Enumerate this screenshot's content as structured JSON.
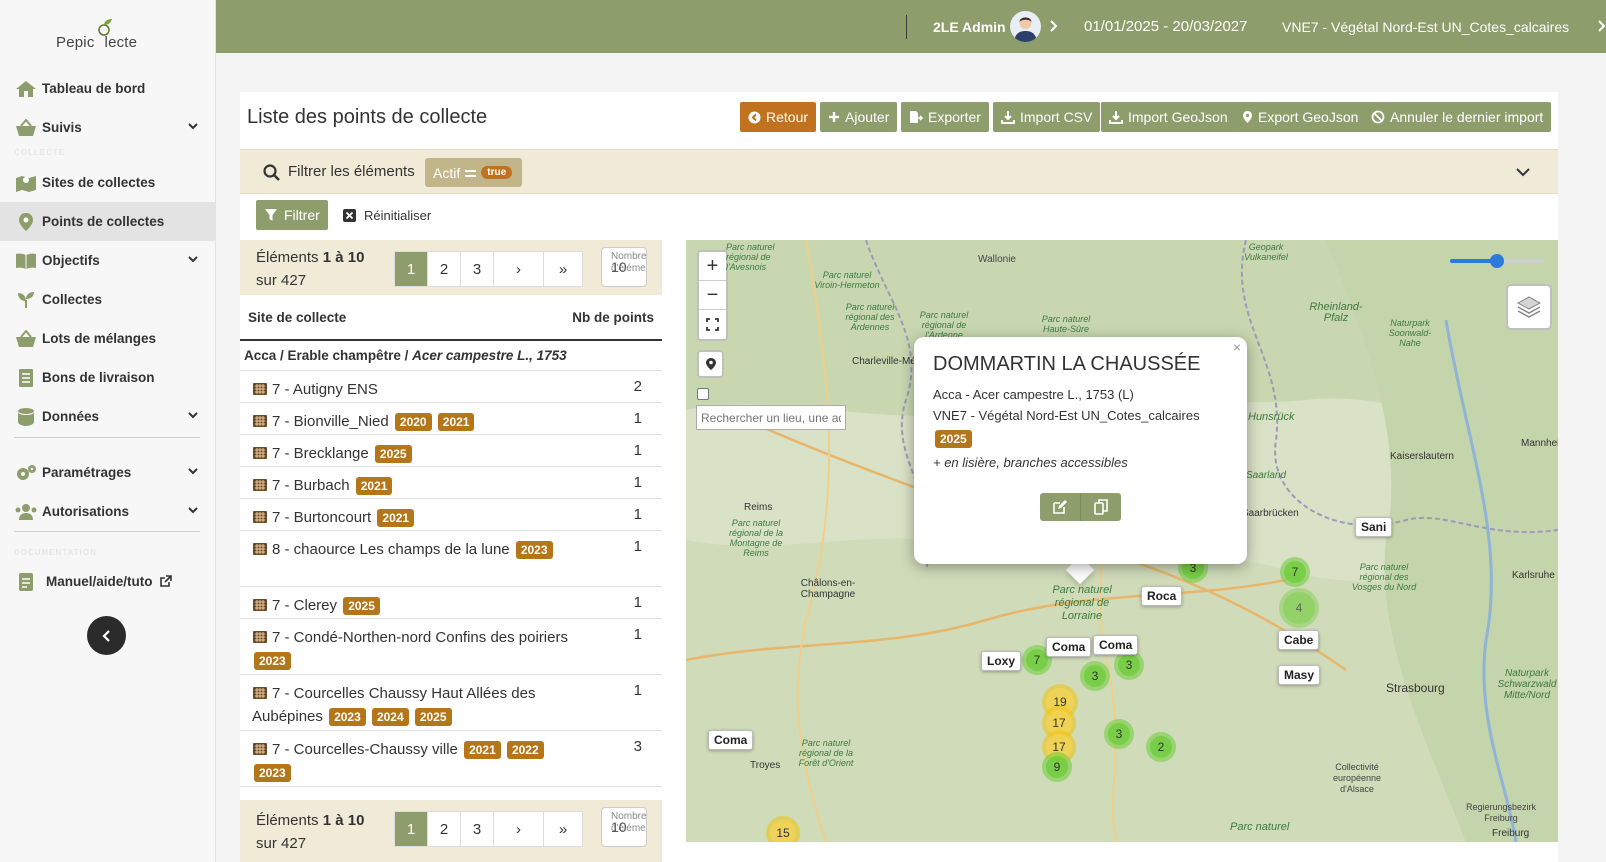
{
  "app": {
    "logo_text": "Pepic",
    "logo_text2": "lecte"
  },
  "sidebar": {
    "items": [
      {
        "label": "Tableau de bord",
        "icon": "home-icon"
      },
      {
        "label": "Suivis",
        "icon": "basket-icon"
      },
      {
        "label": "Sites de collectes",
        "icon": "map-icon"
      },
      {
        "label": "Points de collectes",
        "icon": "map-marker-icon"
      },
      {
        "label": "Objectifs",
        "icon": "book-icon"
      },
      {
        "label": "Collectes",
        "icon": "seedling-icon"
      },
      {
        "label": "Lots de mélanges",
        "icon": "basket-icon"
      },
      {
        "label": "Bons de livraison",
        "icon": "list-icon"
      },
      {
        "label": "Données",
        "icon": "database-icon"
      },
      {
        "label": "Paramétrages",
        "icon": "gears-icon"
      },
      {
        "label": "Autorisations",
        "icon": "users-icon"
      },
      {
        "label": "Manuel/aide/tuto",
        "icon": "file-icon"
      }
    ],
    "section_1": "COLLECTE",
    "section_2": "DOCUMENTATION"
  },
  "topbar": {
    "user": "2LE Admin",
    "dates": "01/01/2025 - 20/03/2027",
    "org": "VNE7 - Végétal Nord-Est UN_Cotes_calcaires"
  },
  "page": {
    "title": "Liste des points de collecte",
    "buttons": {
      "retour": "Retour",
      "ajouter": "Ajouter",
      "exporter": "Exporter",
      "import_csv": "Import CSV",
      "import_geojson": "Import GeoJson",
      "export_geojson": "Export GeoJson",
      "annuler": "Annuler le dernier import"
    }
  },
  "filter": {
    "label": "Filtrer les éléments",
    "chip_field": "Actif",
    "chip_value": "true",
    "filter_button": "Filtrer",
    "reset": "Réinitialiser"
  },
  "pagination": {
    "info_prefix": "Éléments",
    "range": "1 à 10",
    "total": "sur 427",
    "pages": [
      "1",
      "2",
      "3",
      "›",
      "»"
    ],
    "per_page_label": "Nombre d'éléments",
    "per_page_value": "10"
  },
  "table": {
    "col_site": "Site de collecte",
    "col_count": "Nb de points",
    "group": "Acca / Erable champêtre / ",
    "group_italic": "Acer campestre L., 1753",
    "rows": [
      {
        "name": "7 - Autigny ENS",
        "tags": [],
        "count": "2"
      },
      {
        "name": "7 - Bionville_Nied",
        "tags": [
          "2020",
          "2021"
        ],
        "count": "1"
      },
      {
        "name": "7 - Brecklange",
        "tags": [
          "2025"
        ],
        "count": "1"
      },
      {
        "name": "7 - Burbach",
        "tags": [
          "2021"
        ],
        "count": "1"
      },
      {
        "name": "7 - Burtoncourt",
        "tags": [
          "2021"
        ],
        "count": "1"
      },
      {
        "name": "8 - chaource Les champs de la lune",
        "tags": [
          "2023"
        ],
        "count": "1"
      },
      {
        "name": "7 - Clerey",
        "tags": [
          "2025"
        ],
        "count": "1"
      },
      {
        "name": "7 - Condé-Northen-nord Confins des poiriers",
        "tags": [
          "2023"
        ],
        "count": "1"
      },
      {
        "name": "7 - Courcelles Chaussy Haut Allées des Aubépines",
        "tags": [
          "2023",
          "2024",
          "2025"
        ],
        "count": "1"
      },
      {
        "name": "7 - Courcelles-Chaussy ville",
        "tags": [
          "2021",
          "2022",
          "2023"
        ],
        "count": "3"
      }
    ]
  },
  "map": {
    "search_placeholder": "Rechercher un lieu, une adresse",
    "popup": {
      "title": "DOMMARTIN LA CHAUSSÉE",
      "line1": "Acca - Acer campestre L., 1753 (L)",
      "line2": "VNE7 - Végétal Nord-Est UN_Cotes_calcaires",
      "tag": "2025",
      "note": "+ en lisière, branches accessibles"
    },
    "labels": [
      "Sani",
      "Roca",
      "Cabe",
      "Masy",
      "Loxy",
      "Coma",
      "Coma",
      "Coma"
    ],
    "clusters": [
      "7",
      "3",
      "3",
      "3",
      "7",
      "19",
      "17",
      "17",
      "3",
      "9",
      "2",
      "15",
      "4"
    ],
    "places": [
      "Wallonie",
      "Charleville-Mézières",
      "Reims",
      "Châlons-en-Champagne",
      "Troyes",
      "Saarbrücken",
      "Kaiserslautern",
      "Karlsruhe",
      "Strasbourg",
      "Saarland",
      "Mannheim",
      "Hunsrück",
      "Rheinland-Pfalz",
      "Freiburg",
      "Regierungsbezirk Freiburg",
      "Collectivité européenne d'Alsace"
    ],
    "parks": [
      "Parc naturel régional de l'Avesnois",
      "Parc naturel Viroin-Hermeton",
      "Parc naturel régional des Ardennes",
      "Parc naturel régional de l'Ardenne",
      "Parc naturel Haute-Sûre",
      "Geopark Vulkaneifel",
      "Naturpark Soonwald-Nahe",
      "Parc naturel régional de la Montagne de Reims",
      "Parc naturel régional de Lorraine",
      "Parc naturel régional de la Forêt d'Orient",
      "Parc naturel régional des Vosges du Nord",
      "Naturpark Schwarzwald Mitte/Nord",
      "Parc naturel"
    ]
  }
}
